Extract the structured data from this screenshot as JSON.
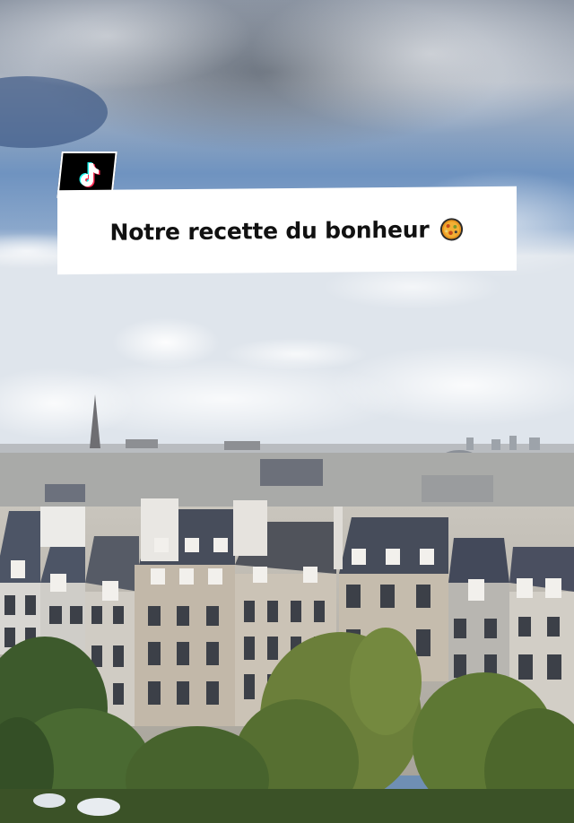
{
  "app": {
    "logo_icon": "tiktok-logo-icon"
  },
  "caption": {
    "text": "Notre recette du bonheur",
    "emoji_icon": "paella-pan-icon"
  },
  "colors": {
    "sky_top": "#9aa4b2",
    "sky_blue": "#5e86bc",
    "caption_bg": "#ffffff",
    "logo_bg": "#000000"
  }
}
